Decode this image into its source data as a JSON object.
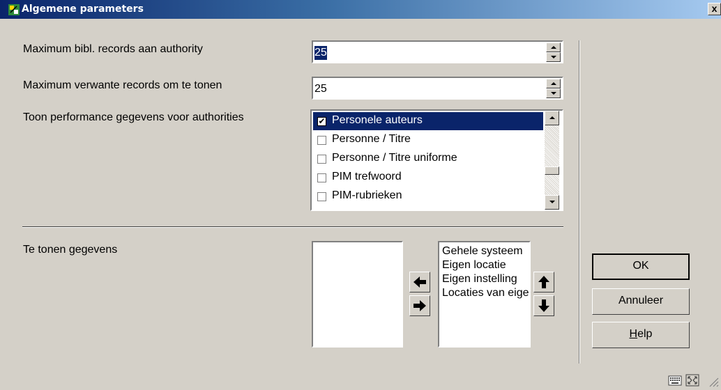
{
  "window": {
    "title": "Algemene parameters",
    "close_label": "x"
  },
  "fields": {
    "max_bibl": {
      "label": "Maximum bibl. records aan authority",
      "value": "25",
      "selected": true
    },
    "max_verwante": {
      "label": "Maximum verwante records om te tonen",
      "value": "25"
    }
  },
  "performance": {
    "label": "Toon performance gegevens voor authorities",
    "items": [
      {
        "label": "Personele auteurs",
        "checked": true,
        "selected": true
      },
      {
        "label": "Personne / Titre",
        "checked": false
      },
      {
        "label": "Personne / Titre uniforme",
        "checked": false
      },
      {
        "label": "PIM trefwoord",
        "checked": false
      },
      {
        "label": "PIM-rubrieken",
        "checked": false
      }
    ]
  },
  "display": {
    "label": "Te tonen gegevens",
    "available": [],
    "selected": [
      "Gehele systeem",
      "Eigen locatie",
      "Eigen instelling",
      "Locaties van eigen instelling"
    ]
  },
  "buttons": {
    "ok": "OK",
    "cancel": "Annuleer",
    "help_prefix": "H",
    "help_rest": "elp"
  },
  "colors": {
    "title_start": "#0a246a",
    "title_end": "#a6caf0",
    "selection": "#0a246a",
    "face": "#d4d0c8"
  }
}
